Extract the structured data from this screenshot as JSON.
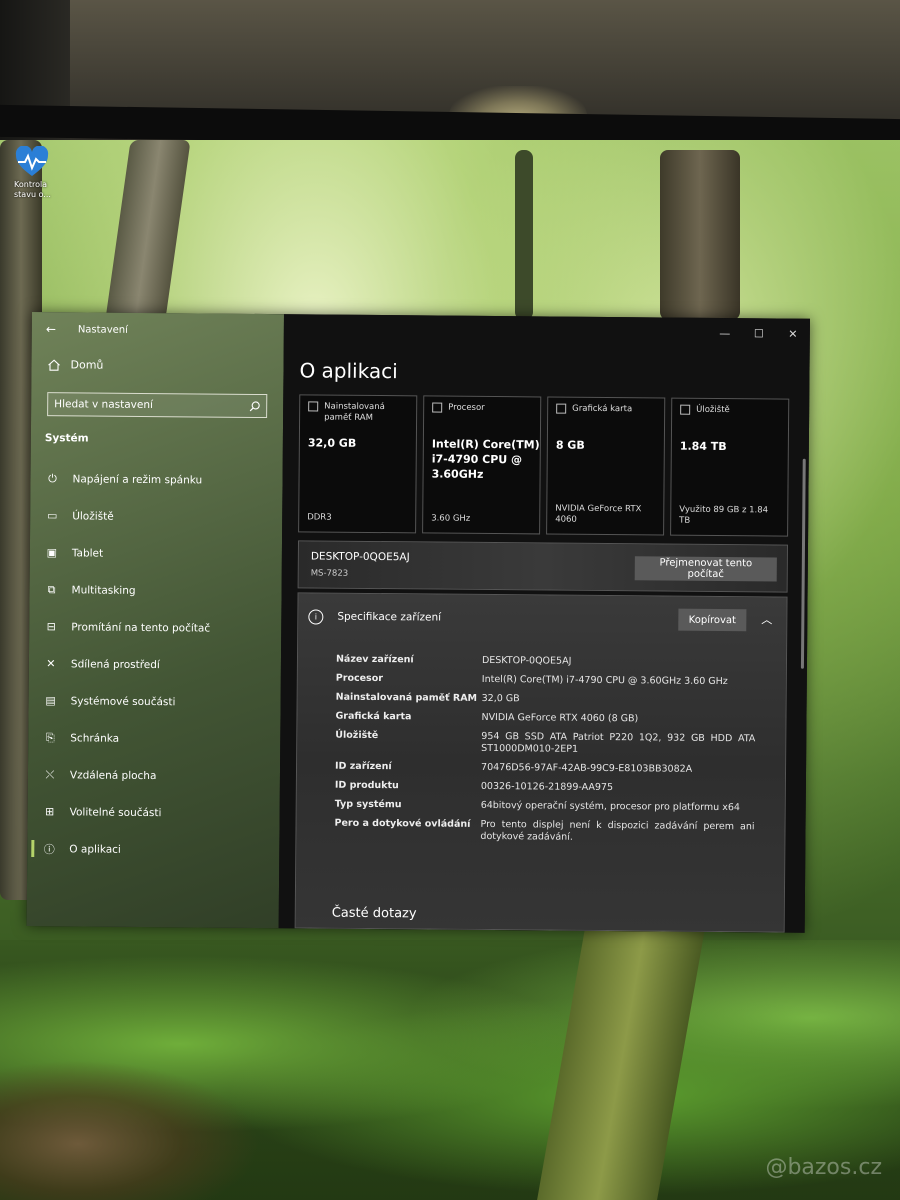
{
  "desktop": {
    "icon_label": "Kontrola stavu o..."
  },
  "window": {
    "title": "Nastavení",
    "caption": {
      "minimize": "—",
      "maximize": "☐",
      "close": "✕"
    }
  },
  "sidebar": {
    "home": "Domů",
    "search_placeholder": "Hledat v nastavení",
    "section": "Systém",
    "items": [
      {
        "label": "Napájení a režim spánku",
        "icon": "power-icon"
      },
      {
        "label": "Úložiště",
        "icon": "storage-icon"
      },
      {
        "label": "Tablet",
        "icon": "tablet-icon"
      },
      {
        "label": "Multitasking",
        "icon": "multitasking-icon"
      },
      {
        "label": "Promítání na tento počítač",
        "icon": "projecting-icon"
      },
      {
        "label": "Sdílená prostředí",
        "icon": "shared-experiences-icon"
      },
      {
        "label": "Systémové součásti",
        "icon": "system-components-icon"
      },
      {
        "label": "Schránka",
        "icon": "clipboard-icon"
      },
      {
        "label": "Vzdálená plocha",
        "icon": "remote-desktop-icon"
      },
      {
        "label": "Volitelné součásti",
        "icon": "optional-features-icon"
      },
      {
        "label": "O aplikaci",
        "icon": "about-icon",
        "active": true
      }
    ]
  },
  "main": {
    "title": "O aplikaci",
    "tiles": [
      {
        "header": "Nainstalovaná paměť RAM",
        "value": "32,0 GB",
        "footer": "DDR3",
        "icon": "ram-icon"
      },
      {
        "header": "Procesor",
        "value": "Intel(R) Core(TM) i7-4790 CPU @ 3.60GHz",
        "footer": "3.60 GHz",
        "icon": "cpu-icon"
      },
      {
        "header": "Grafická karta",
        "value": "8 GB",
        "footer": "NVIDIA GeForce RTX 4060",
        "icon": "gpu-icon"
      },
      {
        "header": "Úložiště",
        "value": "1.84 TB",
        "footer": "Využito 89 GB z 1.84 TB",
        "icon": "storage-icon"
      }
    ],
    "device": {
      "name": "DESKTOP-0QOE5AJ",
      "model": "MS-7823",
      "rename_button": "Přejmenovat tento počítač"
    },
    "spec": {
      "title": "Specifikace zařízení",
      "copy_button": "Kopírovat",
      "rows": [
        {
          "key": "Název zařízení",
          "value": "DESKTOP-0QOE5AJ"
        },
        {
          "key": "Procesor",
          "value": "Intel(R) Core(TM) i7-4790 CPU @ 3.60GHz   3.60 GHz"
        },
        {
          "key": "Nainstalovaná paměť RAM",
          "value": "32,0 GB"
        },
        {
          "key": "Grafická karta",
          "value": "NVIDIA GeForce RTX 4060 (8 GB)"
        },
        {
          "key": "Úložiště",
          "value": "954 GB SSD ATA Patriot P220 1Q2, 932 GB HDD ATA ST1000DM010-2EP1"
        },
        {
          "key": "ID zařízení",
          "value": "70476D56-97AF-42AB-99C9-E8103BB3082A"
        },
        {
          "key": "ID produktu",
          "value": "00326-10126-21899-AA975"
        },
        {
          "key": "Typ systému",
          "value": "64bitový operační systém, procesor pro platformu x64"
        },
        {
          "key": "Pero a dotykové ovládání",
          "value": "Pro tento displej není k dispozici zadávání perem ani dotykové zadávání."
        }
      ]
    },
    "faq": "Časté dotazy"
  },
  "watermark": "@bazos.cz"
}
